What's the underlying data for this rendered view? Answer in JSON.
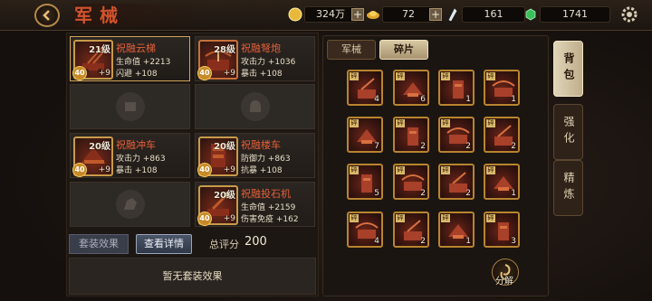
{
  "header": {
    "title": "军械",
    "silver": "324万",
    "gold": "72",
    "crystal": "161",
    "jade": "1741",
    "add_label": "+"
  },
  "equipment": [
    {
      "name": "祝融云梯",
      "level": "21级",
      "stars": "40",
      "plus": "+9",
      "stat1": "生命值 +2213",
      "stat2": "闪避 +108"
    },
    {
      "name": "祝融弩炮",
      "level": "28级",
      "stars": "40",
      "plus": "+9",
      "stat1": "攻击力 +1036",
      "stat2": "暴击 +108"
    },
    {
      "name": "祝融冲车",
      "level": "20级",
      "stars": "40",
      "plus": "+9",
      "stat1": "攻击力 +863",
      "stat2": "暴击 +108"
    },
    {
      "name": "祝融楼车",
      "level": "20级",
      "stars": "40",
      "plus": "+9",
      "stat1": "防御力 +863",
      "stat2": "抗暴 +108"
    },
    {
      "name": "祝融投石机",
      "level": "20级",
      "stars": "40",
      "plus": "+9",
      "stat1": "生命值 +2159",
      "stat2": "伤害免疫 +162"
    }
  ],
  "buttons": {
    "set_effect": "套装效果",
    "view_detail": "查看详情",
    "decompose": "分解"
  },
  "score": {
    "label": "总评分",
    "value": "200"
  },
  "no_set_text": "暂无套装效果",
  "tabs": {
    "armory": "军械",
    "fragments": "碎片"
  },
  "fragment_tag": "碎",
  "fragments": [
    "4",
    "6",
    "1",
    "1",
    "7",
    "2",
    "2",
    "2",
    "5",
    "2",
    "2",
    "1",
    "4",
    "2",
    "1",
    "3"
  ],
  "side_tabs": {
    "bag": "背包",
    "enhance": "强化",
    "refine": "精炼"
  }
}
